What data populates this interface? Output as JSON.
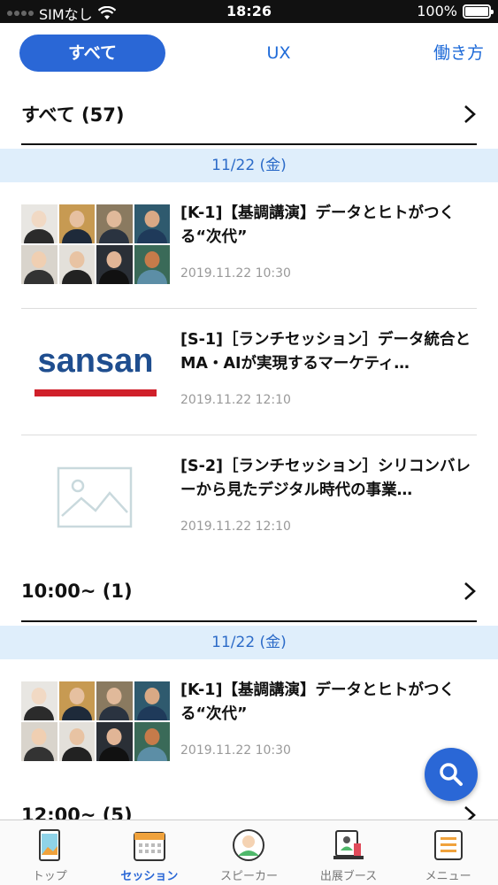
{
  "status_bar": {
    "carrier": "SIMなし",
    "time": "18:26",
    "battery": "100%"
  },
  "tabs": [
    {
      "label": "すべて",
      "active": true
    },
    {
      "label": "UX",
      "active": false
    },
    {
      "label": "働き方",
      "active": false
    }
  ],
  "sections": [
    {
      "title": "すべて (57)",
      "date": "11/22 (金)",
      "sessions": [
        {
          "title": "[K-1]【基調講演】データとヒトがつくる“次代”",
          "datetime": "2019.11.22 10:30",
          "thumbnail": "speaker-photos"
        },
        {
          "title": "[S-1]［ランチセッション］データ統合とMA・AIが実現するマーケティ…",
          "datetime": "2019.11.22 12:10",
          "thumbnail": "sansan-logo"
        },
        {
          "title": "[S-2]［ランチセッション］シリコンバレーから見たデジタル時代の事業…",
          "datetime": "2019.11.22 12:10",
          "thumbnail": "image-placeholder"
        }
      ]
    },
    {
      "title": "10:00~ (1)",
      "date": "11/22 (金)",
      "sessions": [
        {
          "title": "[K-1]【基調講演】データとヒトがつくる“次代”",
          "datetime": "2019.11.22 10:30",
          "thumbnail": "speaker-photos"
        }
      ]
    },
    {
      "title": "12:00~ (5)"
    }
  ],
  "logo_text": "sansan",
  "bottom_nav": [
    {
      "label": "トップ",
      "icon": "tablet-icon",
      "active": false
    },
    {
      "label": "セッション",
      "icon": "calendar-icon",
      "active": true
    },
    {
      "label": "スピーカー",
      "icon": "person-icon",
      "active": false
    },
    {
      "label": "出展ブース",
      "icon": "booth-icon",
      "active": false
    },
    {
      "label": "メニュー",
      "icon": "menu-icon",
      "active": false
    }
  ],
  "colors": {
    "accent": "#2a67d6",
    "date_bar_bg": "#dfeefb",
    "date_text": "#2c6bc8",
    "logo_blue": "#1f4e8f",
    "logo_red": "#d0202a"
  }
}
